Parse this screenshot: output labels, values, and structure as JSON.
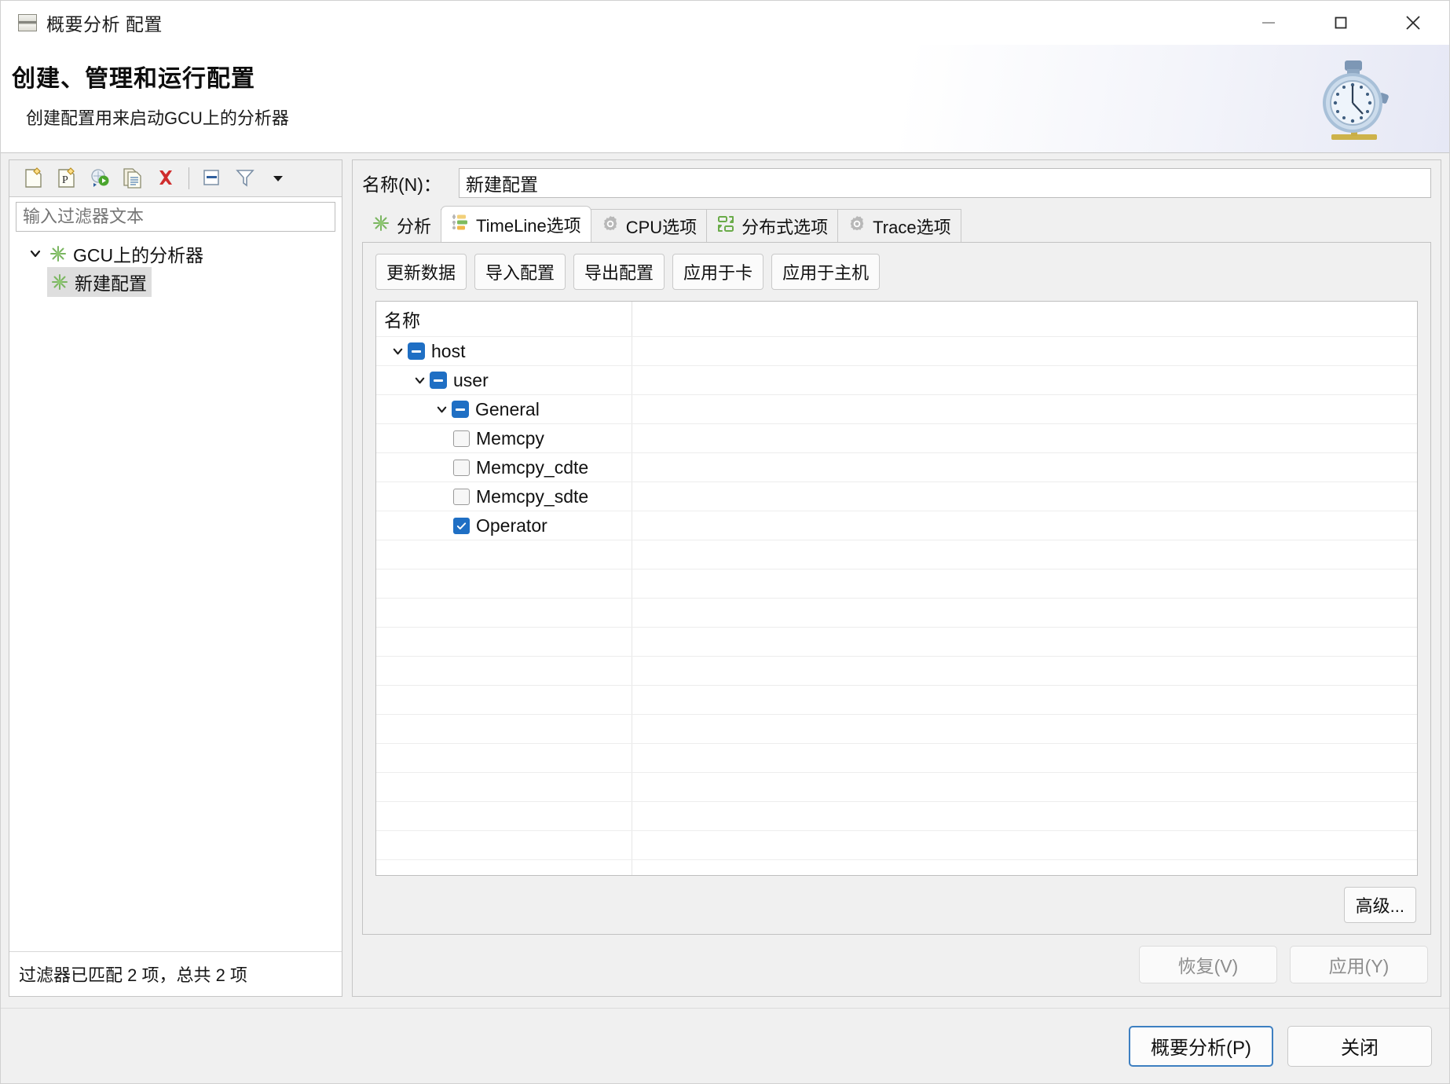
{
  "window": {
    "title": "概要分析 配置",
    "icon": "window-icon",
    "controls": {
      "minimize": "—",
      "maximize": "□",
      "close": "✕"
    }
  },
  "header": {
    "heading": "创建、管理和运行配置",
    "subheading": "创建配置用来启动GCU上的分析器",
    "decoration_icon": "stopwatch-icon"
  },
  "left_panel": {
    "toolbar": [
      {
        "name": "new-configuration-icon",
        "title": "新建配置"
      },
      {
        "name": "new-prototype-icon",
        "title": "新建原型"
      },
      {
        "name": "export-run-icon",
        "title": "导出/运行"
      },
      {
        "name": "duplicate-icon",
        "title": "复制"
      },
      {
        "name": "delete-icon",
        "title": "删除"
      },
      {
        "name": "collapse-all-icon",
        "title": "全部折叠"
      },
      {
        "name": "filter-icon",
        "title": "过滤"
      },
      {
        "name": "chevron-down-icon",
        "title": "更多"
      }
    ],
    "filter": {
      "placeholder": "输入过滤器文本",
      "value": ""
    },
    "tree": {
      "root": {
        "label": "GCU上的分析器",
        "expanded": true,
        "icon": "analyzer-icon"
      },
      "children": [
        {
          "label": "新建配置",
          "icon": "analyzer-icon",
          "selected": true
        }
      ]
    },
    "status": "过滤器已匹配 2 项，总共 2 项"
  },
  "right_panel": {
    "name_field": {
      "label": "名称(N)：",
      "value": "新建配置",
      "placeholder": ""
    },
    "tabs": [
      {
        "label": "分析",
        "icon": "analyzer-icon",
        "active": false
      },
      {
        "label": "TimeLine选项",
        "icon": "timeline-icon",
        "active": true
      },
      {
        "label": "CPU选项",
        "icon": "gear-icon",
        "active": false
      },
      {
        "label": "分布式选项",
        "icon": "distributed-icon",
        "active": false
      },
      {
        "label": "Trace选项",
        "icon": "gear-icon",
        "active": false
      }
    ],
    "action_buttons": [
      {
        "label": "更新数据",
        "name": "refresh-data-button"
      },
      {
        "label": "导入配置",
        "name": "import-config-button"
      },
      {
        "label": "导出配置",
        "name": "export-config-button"
      },
      {
        "label": "应用于卡",
        "name": "apply-to-card-button"
      },
      {
        "label": "应用于主机",
        "name": "apply-to-host-button"
      }
    ],
    "table": {
      "columns": [
        "名称",
        ""
      ],
      "rows": [
        {
          "label": "host",
          "depth": 0,
          "type": "tristate",
          "expanded": true,
          "checked": "partial"
        },
        {
          "label": "user",
          "depth": 1,
          "type": "tristate",
          "expanded": true,
          "checked": "partial"
        },
        {
          "label": "General",
          "depth": 2,
          "type": "tristate",
          "expanded": true,
          "checked": "partial"
        },
        {
          "label": "Memcpy",
          "depth": 3,
          "type": "checkbox",
          "expanded": false,
          "checked": "off"
        },
        {
          "label": "Memcpy_cdte",
          "depth": 3,
          "type": "checkbox",
          "expanded": false,
          "checked": "off"
        },
        {
          "label": "Memcpy_sdte",
          "depth": 3,
          "type": "checkbox",
          "expanded": false,
          "checked": "off"
        },
        {
          "label": "Operator",
          "depth": 3,
          "type": "checkbox",
          "expanded": false,
          "checked": "on"
        }
      ],
      "empty_rows": 14
    },
    "advanced_button": "高级...",
    "revert_button": "恢复(V)",
    "apply_button": "应用(Y)"
  },
  "footer": {
    "primary_button": "概要分析(P)",
    "close_button": "关闭"
  },
  "colors": {
    "accent": "#1f6fc4",
    "tab_active_bg": "#ffffff",
    "panel_bg": "#f0f0f0",
    "focus_border": "#3d7fc1",
    "disabled_text": "#8d8d8d"
  }
}
